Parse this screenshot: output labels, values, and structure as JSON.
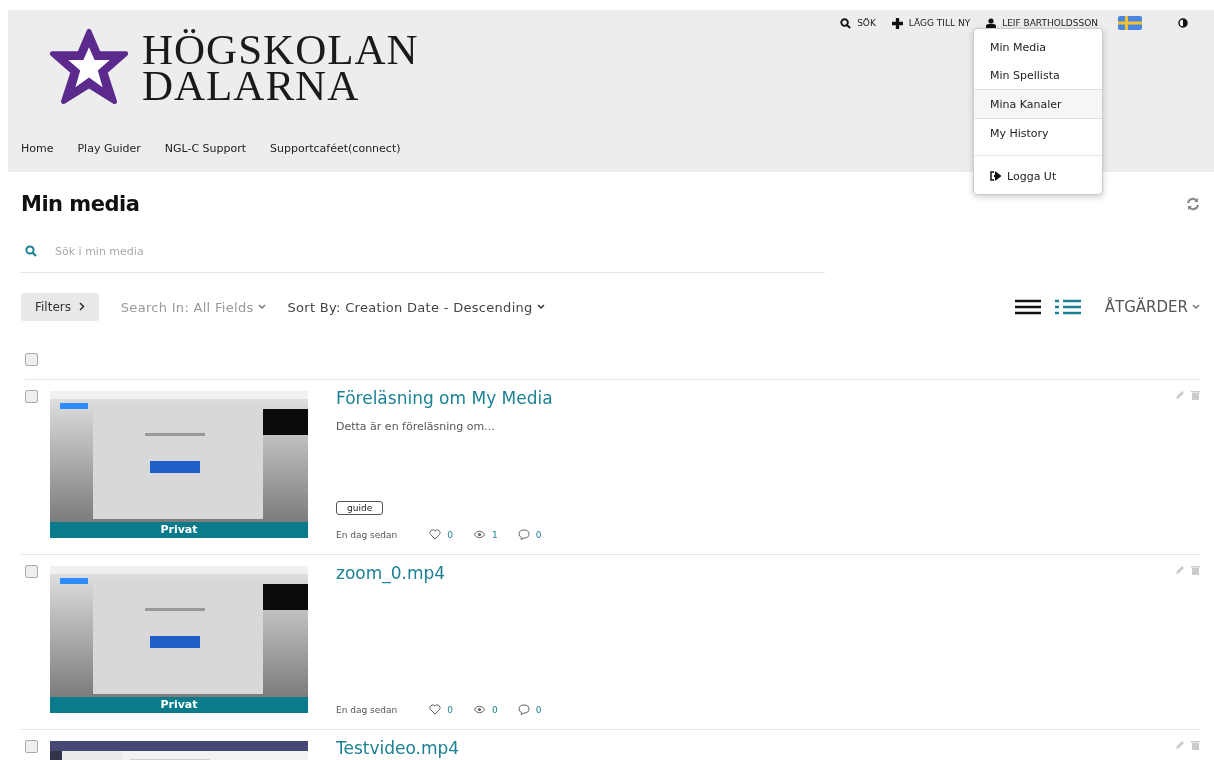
{
  "logo": {
    "line_1": "HÖGSKOLAN",
    "line_2": "DALARNA"
  },
  "nav": [
    "Home",
    "Play Guider",
    "NGL-C Support",
    "Supportcaféet(connect)"
  ],
  "top_bar": {
    "search": "SÖK",
    "add": "LÄGG TILL NY",
    "user": "LEIF BARTHOLDSSON"
  },
  "user_menu": [
    {
      "label": "Min Media",
      "kind": "link",
      "hovered": false
    },
    {
      "label": "Min Spellista",
      "kind": "link",
      "hovered": false
    },
    {
      "label": "Mina Kanaler",
      "kind": "link",
      "hovered": true
    },
    {
      "label": "My History",
      "kind": "link",
      "hovered": false
    },
    {
      "label": "Logga Ut",
      "kind": "logout",
      "hovered": false
    }
  ],
  "page_title": "Min media",
  "search": {
    "placeholder": "Sök i min media"
  },
  "toolbar": {
    "filters": "Filters",
    "search_in": "Search In: All Fields",
    "sort_by": "Sort By: Creation Date - Descending",
    "actions": "ÅTGÄRDER"
  },
  "views": [
    {
      "kind": "list",
      "selected": false
    },
    {
      "kind": "detailed",
      "selected": true
    }
  ],
  "select_all": {
    "checked": false
  },
  "entries": [
    {
      "title": "Föreläsning om My Media",
      "description": "Detta är en föreläsning om...",
      "tag": "guide",
      "badge": "Privat",
      "time": "En dag sedan",
      "likes": "0",
      "views": "1",
      "comments": "0",
      "checked": false
    },
    {
      "title": "zoom_0.mp4",
      "badge": "Privat",
      "time": "En dag sedan",
      "likes": "0",
      "views": "0",
      "comments": "0",
      "checked": false
    },
    {
      "title": "Testvideo.mp4",
      "checked": false
    }
  ]
}
